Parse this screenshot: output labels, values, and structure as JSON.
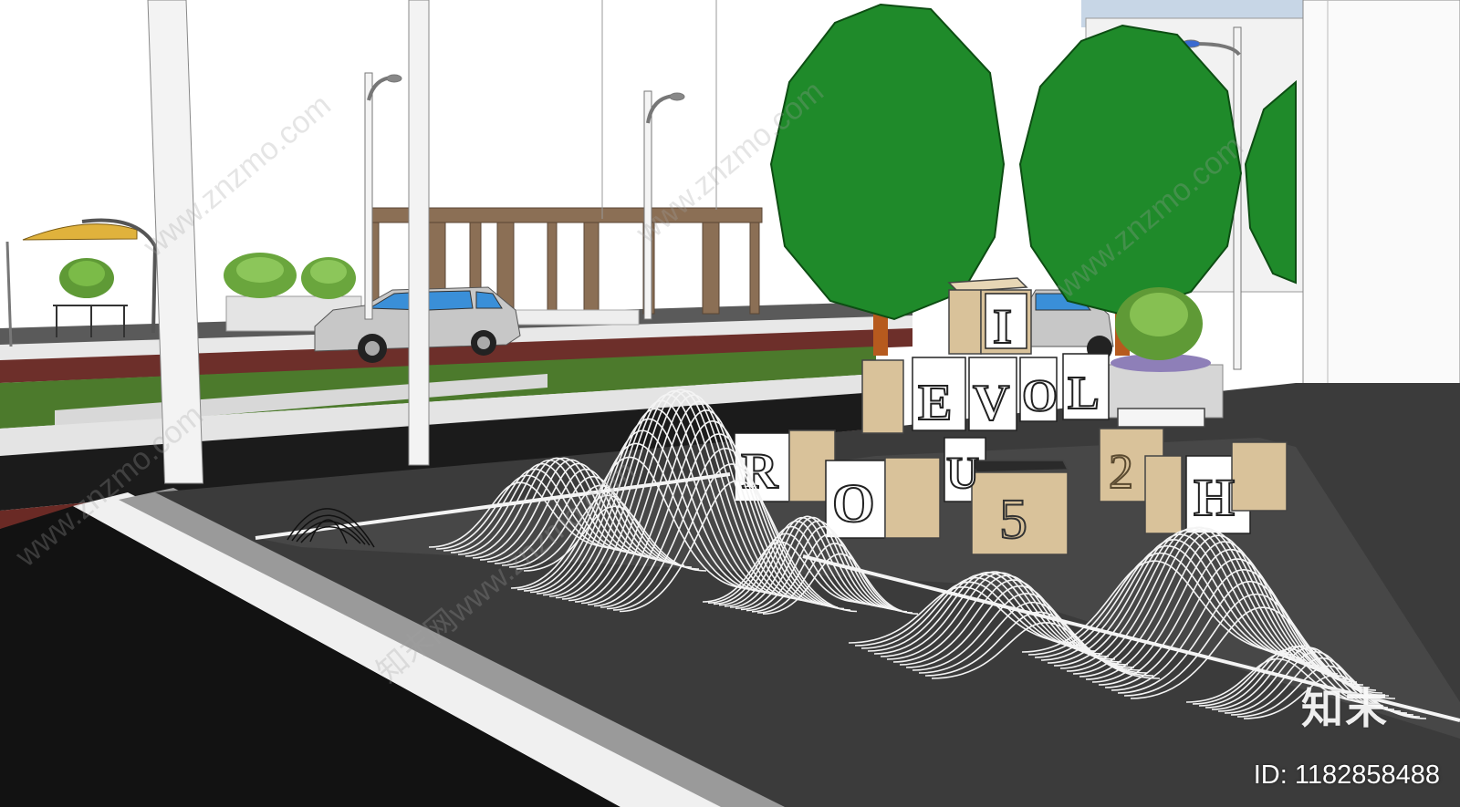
{
  "scene": {
    "type": "3D street landscape model render",
    "colors": {
      "sky": "#ffffff",
      "tree": "#1f8a2a",
      "tree_dark": "#126b1b",
      "trunk": "#b65a1e",
      "road": "#1c1c1c",
      "plaza": "#3a3a3a",
      "grass": "#4f7d2c",
      "pergola": "#8b6f55",
      "block": "#d9c29a",
      "car": "#b9b9b9",
      "umbrella": "#e0b23c"
    },
    "block_letters": [
      "I",
      "E",
      "V",
      "O",
      "L",
      "R",
      "O",
      "U",
      "5",
      "2",
      "H"
    ]
  },
  "watermark": {
    "logo": "知末",
    "id_text": "ID: 1182858488",
    "diagonal": [
      "www.znzmo.com",
      "www.znzmo.com",
      "www.znzmo.com",
      "www.znzmo.com",
      "知末网www.znzmo.com"
    ]
  }
}
